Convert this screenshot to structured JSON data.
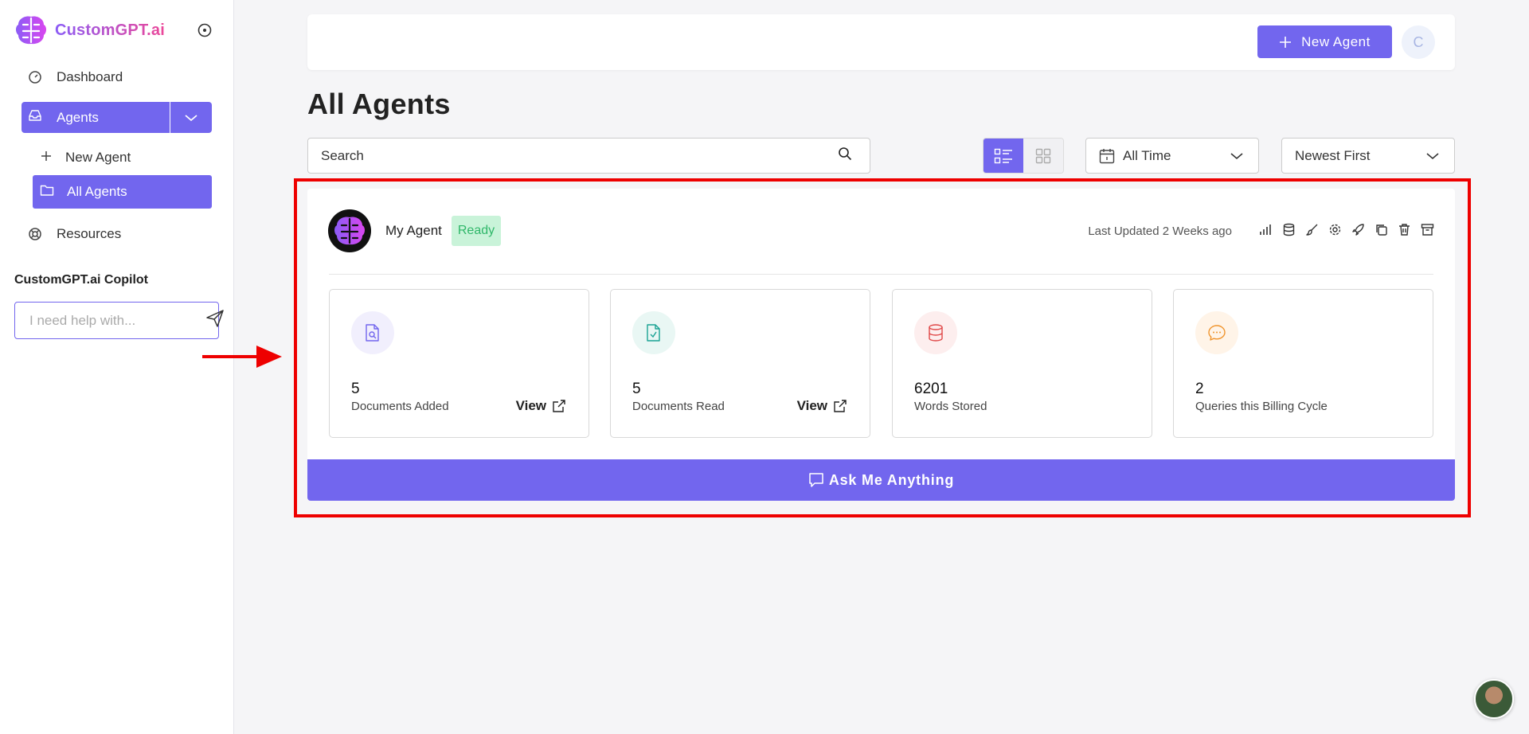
{
  "brand": {
    "name": "CustomGPT.ai"
  },
  "sidebar": {
    "dashboard_label": "Dashboard",
    "agents_label": "Agents",
    "new_agent_label": "New Agent",
    "all_agents_label": "All Agents",
    "resources_label": "Resources",
    "copilot_title": "CustomGPT.ai Copilot",
    "copilot_placeholder": "I need help with..."
  },
  "header": {
    "new_agent_button": "New Agent",
    "avatar_initial": "C"
  },
  "page": {
    "title": "All Agents",
    "search_placeholder": "Search",
    "time_filter": "All Time",
    "sort": "Newest First"
  },
  "agent": {
    "name": "My Agent",
    "status": "Ready",
    "last_updated": "Last Updated 2 Weeks ago",
    "stats": [
      {
        "value": "5",
        "label": "Documents Added",
        "action": "View"
      },
      {
        "value": "5",
        "label": "Documents Read",
        "action": "View"
      },
      {
        "value": "6201",
        "label": "Words Stored"
      },
      {
        "value": "2",
        "label": "Queries this Billing Cycle"
      }
    ],
    "ask_button": "Ask Me Anything"
  },
  "colors": {
    "accent": "#7266ee",
    "ready_bg": "#c9f3d9",
    "ready_text": "#2fb769",
    "highlight": "#ee0000"
  }
}
